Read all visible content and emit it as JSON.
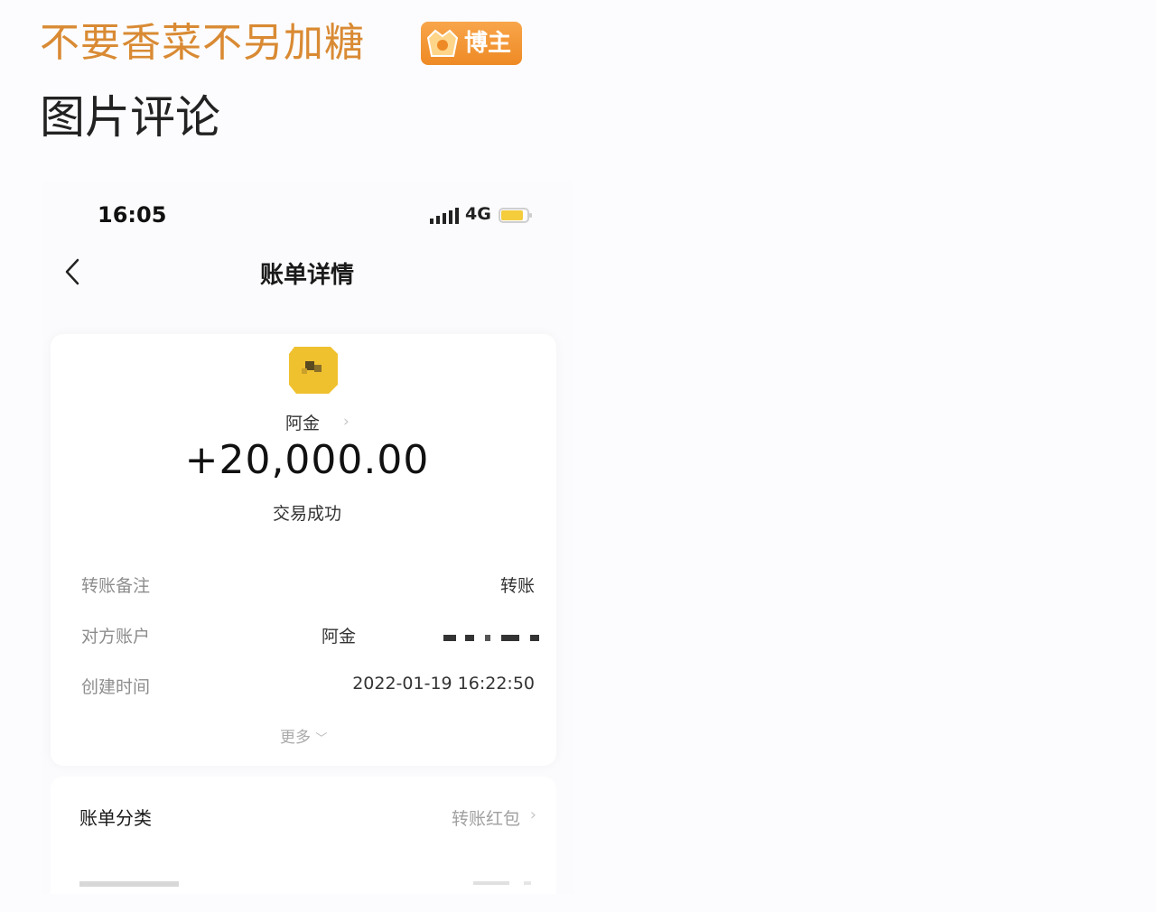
{
  "comment": {
    "username": "不要香菜不另加糖",
    "badge_label": "博主",
    "section_title": "图片评论"
  },
  "phone": {
    "status_bar": {
      "time": "16:05",
      "network": "4G"
    },
    "nav": {
      "title": "账单详情"
    },
    "bill": {
      "payee_name": "阿金",
      "amount": "+20,000.00",
      "status": "交易成功",
      "rows": [
        {
          "label": "转账备注",
          "value": "转账"
        },
        {
          "label": "对方账户",
          "value": "阿金"
        },
        {
          "label": "创建时间",
          "value": "2022-01-19 16:22:50"
        }
      ],
      "more_label": "更多"
    },
    "category": {
      "label": "账单分类",
      "value": "转账红包"
    }
  },
  "colors": {
    "username": "#d98a33",
    "badge_bg": "#ef8d28",
    "avatar": "#f0c12f",
    "battery_fill": "#f4cc3c"
  },
  "icons": [
    "back-chevron-icon",
    "signal-icon",
    "battery-icon",
    "badge-crown-icon",
    "chevron-right-icon",
    "chevron-down-icon"
  ]
}
